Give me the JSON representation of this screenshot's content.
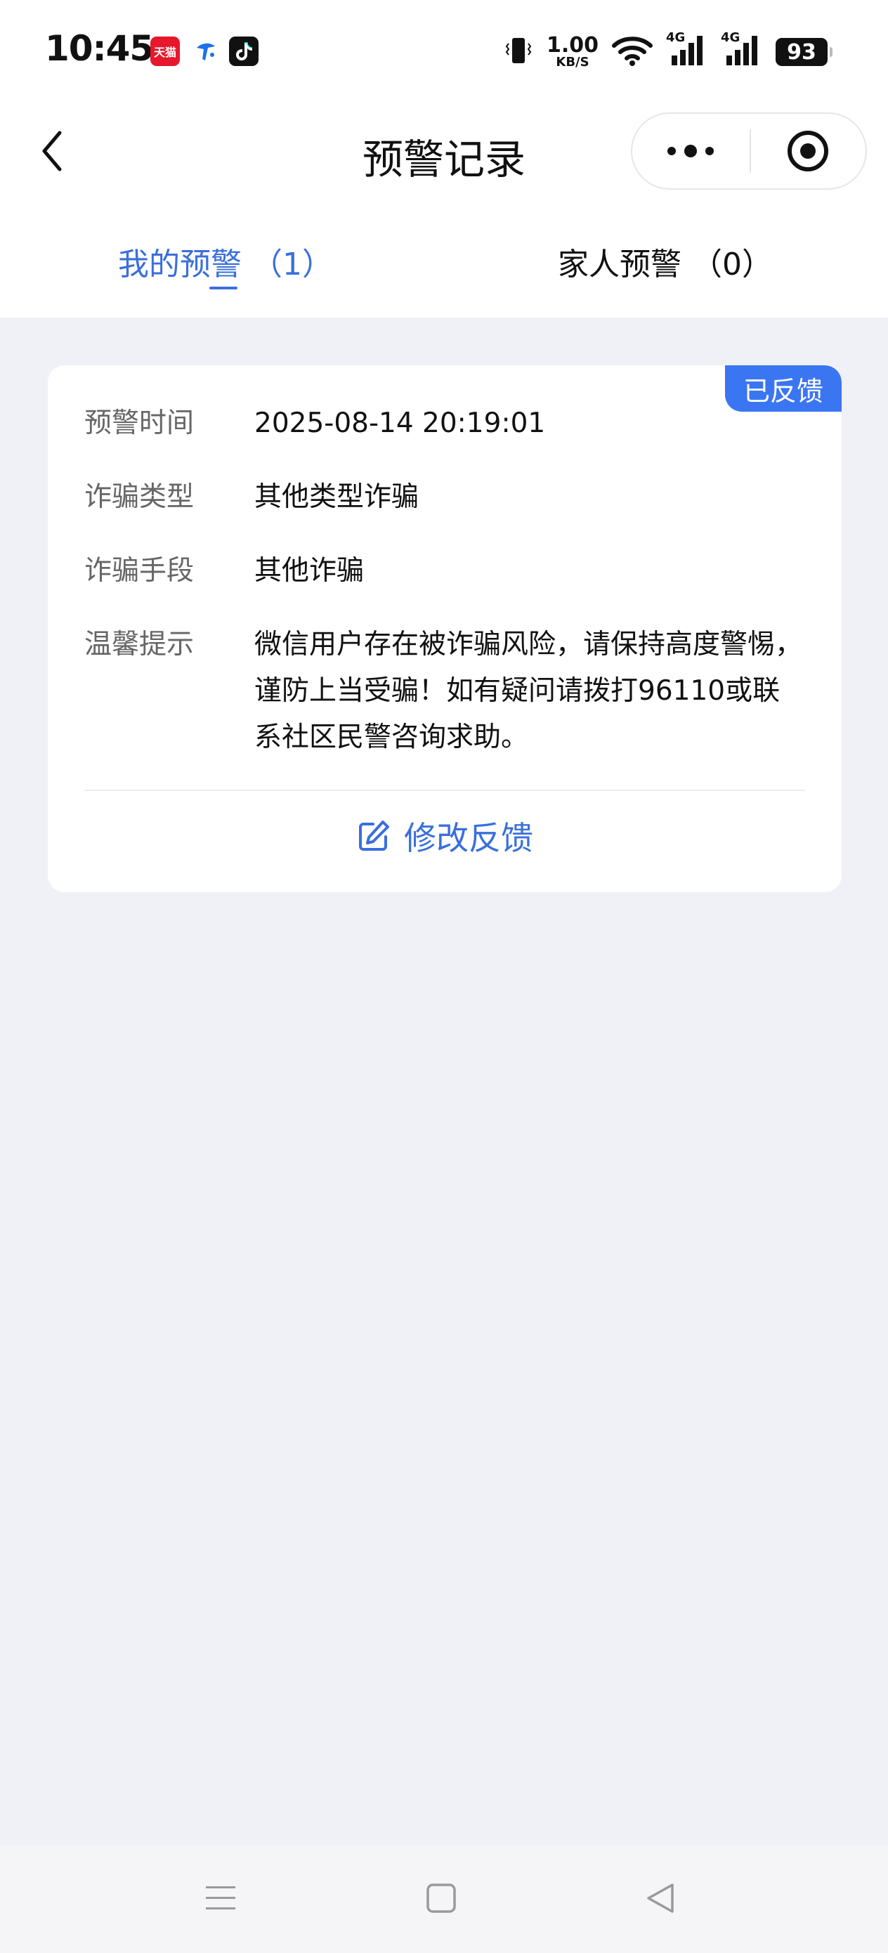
{
  "status_bar": {
    "time": "10:45",
    "apps": [
      {
        "name": "tmall",
        "label": "天猫",
        "color": "#e8172c"
      },
      {
        "name": "telecom",
        "label": "",
        "color": "#1a73e8"
      },
      {
        "name": "tiktok",
        "label": "",
        "color": "#111111"
      }
    ],
    "net_speed_value": "1.00",
    "net_speed_unit": "KB/S",
    "network_1": "4G",
    "network_2": "4G",
    "battery": "93",
    "icons": [
      "vibrate-icon",
      "wifi-icon",
      "signal-icon",
      "signal-icon",
      "battery-icon"
    ]
  },
  "nav": {
    "title": "预警记录",
    "back_icon": "chevron-left-icon",
    "more_icon": "more-dots-icon",
    "close_icon": "target-circle-icon"
  },
  "tabs": [
    {
      "label": "我的预警 （1）",
      "active": true
    },
    {
      "label": "家人预警 （0）",
      "active": false
    }
  ],
  "card": {
    "status": "已反馈",
    "fields": [
      {
        "label": "预警时间",
        "value": "2025-08-14 20:19:01"
      },
      {
        "label": "诈骗类型",
        "value": "其他类型诈骗"
      },
      {
        "label": "诈骗手段",
        "value": "其他诈骗"
      },
      {
        "label": "温馨提示",
        "value": "微信用户存在被诈骗风险，请保持高度警惕，谨防上当受骗！如有疑问请拨打96110或联系社区民警咨询求助。"
      }
    ],
    "action_label": "修改反馈",
    "action_icon": "edit-icon"
  },
  "colors": {
    "accent": "#3a6fdc",
    "badge": "#3b76f2",
    "background": "#f0f1f6"
  },
  "system_nav": {
    "icons": [
      "menu-icon",
      "home-icon",
      "back-icon"
    ]
  }
}
